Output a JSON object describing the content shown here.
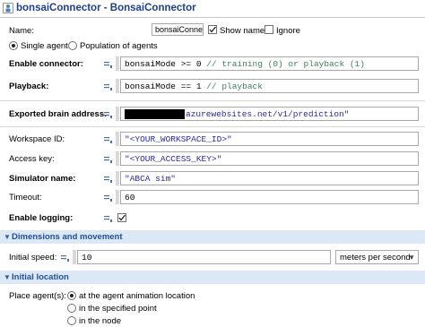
{
  "window": {
    "title": "bonsaiConnector - BonsaiConnector",
    "icon": "agent-type-icon"
  },
  "name_row": {
    "label": "Name:",
    "value": "bonsaiConnector",
    "show_name_label": "Show name",
    "show_name_checked": true,
    "ignore_label": "Ignore",
    "ignore_checked": false
  },
  "agent_mode": {
    "single_label": "Single agent",
    "population_label": "Population of agents",
    "selected": "Single agent"
  },
  "fields": {
    "enable_connector": {
      "label": "Enable connector:",
      "code": "bonsaiMode >= 0",
      "comment": "// training (0) or playback (1)"
    },
    "playback": {
      "label": "Playback:",
      "code": "bonsaiMode == 1",
      "comment": "// playback"
    },
    "exported_brain_address": {
      "label": "Exported brain address:",
      "value_suffix": "azurewebsites.net/v1/prediction\""
    },
    "workspace_id": {
      "label": "Workspace ID:",
      "value": "\"<YOUR_WORKSPACE_ID>\""
    },
    "access_key": {
      "label": "Access key:",
      "value": "\"<YOUR_ACCESS_KEY>\""
    },
    "simulator_name": {
      "label": "Simulator name:",
      "value": "\"ABCA sim\""
    },
    "timeout": {
      "label": "Timeout:",
      "value": "60"
    },
    "enable_logging": {
      "label": "Enable logging:",
      "checked": true
    }
  },
  "dimensions_section": {
    "title": "Dimensions and movement",
    "initial_speed_label": "Initial speed:",
    "initial_speed_value": "10",
    "speed_unit": "meters per second"
  },
  "location_section": {
    "title": "Initial location",
    "place_label": "Place agent(s):",
    "options": [
      "at the agent animation location",
      "in the specified point",
      "in the node"
    ],
    "selected_index": 0
  }
}
